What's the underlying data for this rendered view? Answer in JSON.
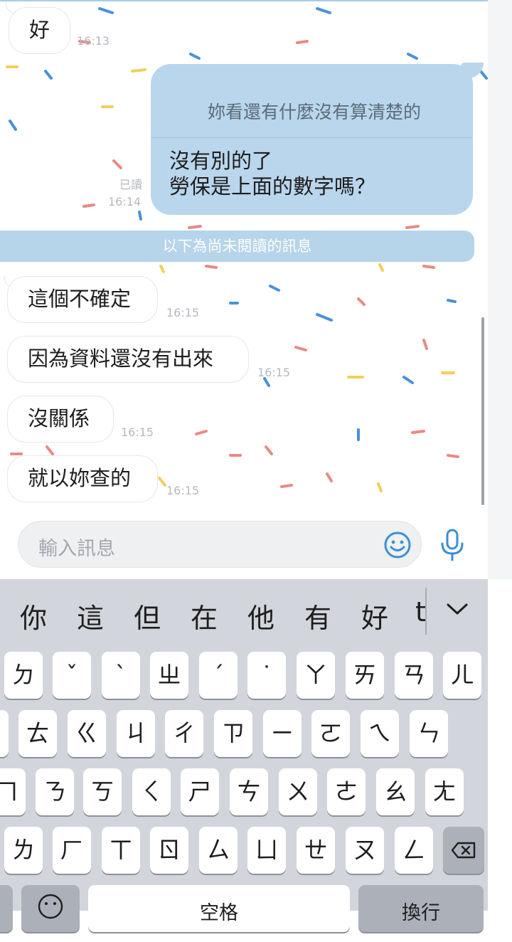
{
  "messages": {
    "incoming_top": {
      "text": "好",
      "time": "16:13"
    },
    "outgoing": {
      "quote": "妳看還有什麼沒有算清楚的",
      "line1": "沒有別的了",
      "line2": "勞保是上面的數字嗎？",
      "read": "已讀",
      "time": "16:14"
    },
    "unread_divider": "以下為尚未閱讀的訊息",
    "incoming": [
      {
        "text": "這個不確定",
        "time": "16:15"
      },
      {
        "text": "因為資料還沒有出來",
        "time": "16:15"
      },
      {
        "text": "沒關係",
        "time": "16:15"
      },
      {
        "text": "就以妳查的",
        "time": "16:15"
      }
    ]
  },
  "input": {
    "placeholder": "輸入訊息",
    "emoji_icon": "smiley-icon",
    "mic_icon": "microphone-icon"
  },
  "keyboard": {
    "candidates": [
      "你",
      "這",
      "但",
      "在",
      "他",
      "有",
      "好",
      "t"
    ],
    "row1": [
      "ㄉ",
      "ˇ",
      "ˋ",
      "ㄓ",
      "ˊ",
      "˙",
      "ㄚ",
      "ㄞ",
      "ㄢ",
      "ㄦ"
    ],
    "row2": [
      "ㄊ",
      "ㄍ",
      "ㄐ",
      "ㄔ",
      "ㄗ",
      "ㄧ",
      "ㄛ",
      "ㄟ",
      "ㄣ"
    ],
    "row3": [
      "ㄇ",
      "ㄋ",
      "ㄎ",
      "ㄑ",
      "ㄕ",
      "ㄘ",
      "ㄨ",
      "ㄜ",
      "ㄠ",
      "ㄤ"
    ],
    "row4": [
      "ㄌ",
      "ㄏ",
      "ㄒ",
      "ㄖ",
      "ㄙ",
      "ㄩ",
      "ㄝ",
      "ㄡ",
      "ㄥ"
    ],
    "space_label": "空格",
    "return_label": "換行"
  },
  "colors": {
    "outgoing_bubble": "#b9d6ec",
    "unread_bar": "#b6d4ea",
    "accent": "#3b8fd4"
  }
}
